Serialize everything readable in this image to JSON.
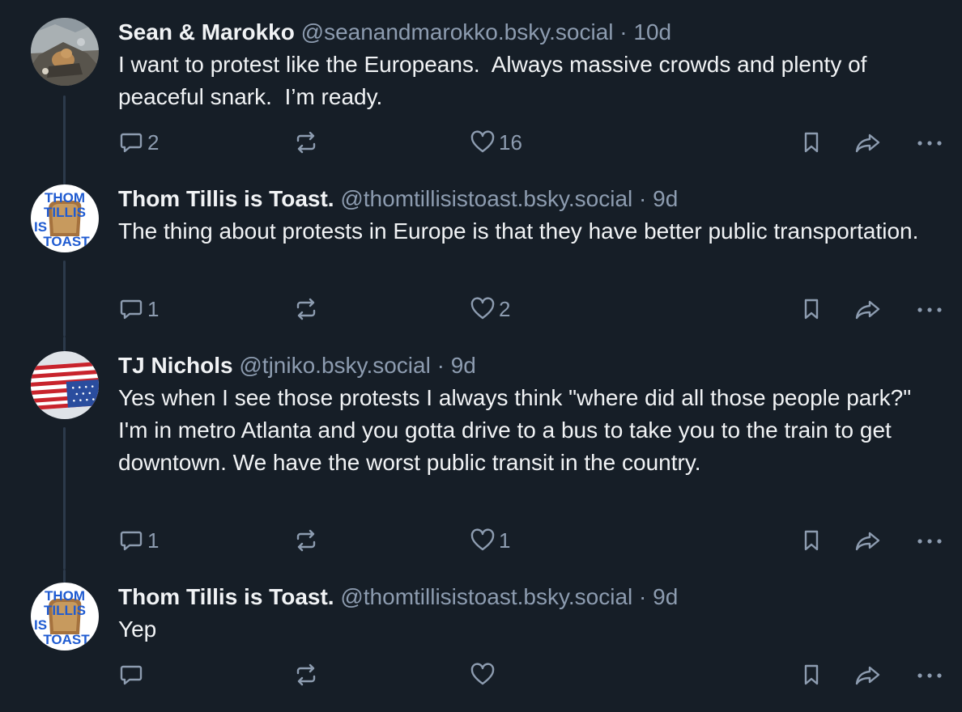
{
  "posts": [
    {
      "display_name": "Sean & Marokko",
      "handle": "@seanandmarokko.bsky.social",
      "separator": "·",
      "time": "10d",
      "text": "I want to protest like the Europeans.  Always massive crowds and plenty of peaceful snark.  I’m ready.",
      "reply_count": "2",
      "repost_count": "",
      "like_count": "16",
      "avatar": "photo"
    },
    {
      "display_name": "Thom Tillis is Toast.",
      "handle": "@thomtillisistoast.bsky.social",
      "separator": "·",
      "time": "9d",
      "text": "The thing about protests in Europe is that they have better public transportation.",
      "reply_count": "1",
      "repost_count": "",
      "like_count": "2",
      "avatar": "toast-logo"
    },
    {
      "display_name": "TJ Nichols",
      "handle": "@tjniko.bsky.social",
      "separator": "·",
      "time": "9d",
      "text": "Yes when I see those protests I always think \"where did all those people park?\" I'm in metro Atlanta and you gotta drive to a bus to take you to the train to get downtown. We have the worst public transit in the country.",
      "reply_count": "1",
      "repost_count": "",
      "like_count": "1",
      "avatar": "upside-down-flag"
    },
    {
      "display_name": "Thom Tillis is Toast.",
      "handle": "@thomtillisistoast.bsky.social",
      "separator": "·",
      "time": "9d",
      "text": "Yep",
      "reply_count": "",
      "repost_count": "",
      "like_count": "",
      "avatar": "toast-logo"
    }
  ],
  "logo_text": {
    "line1": "THOM",
    "line2": "TILLIS",
    "line3": "IS",
    "line4": "TOAST"
  },
  "icons": {
    "reply": "speech-bubble-icon",
    "repost": "repost-arrows-icon",
    "like": "heart-icon",
    "bookmark": "bookmark-icon",
    "share": "share-arrow-icon",
    "more": "ellipsis-icon"
  },
  "colors": {
    "background": "#161e27",
    "text": "#f1f3f5",
    "muted": "#8d9cb0",
    "thread_line": "#2c3a4b"
  }
}
